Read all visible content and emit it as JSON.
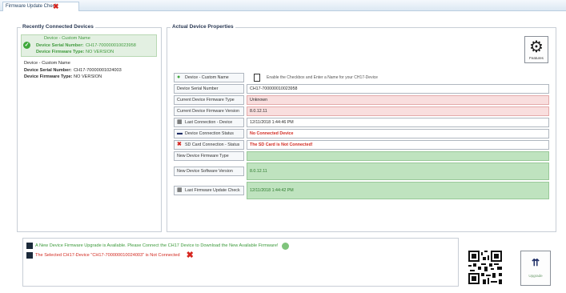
{
  "window": {
    "tab_title": "Firmware Update Check"
  },
  "recent": {
    "title": "Recently Connected Devices",
    "devices": [
      {
        "name": "Device - Custom Name",
        "serial_label": "Device Serial Number:",
        "serial": "CH17-700000010023958",
        "fw_label": "Device Firmware Type:",
        "fw": "NO VERSION"
      },
      {
        "name": "Device - Custom Name",
        "serial_label": "Device Serial Number:",
        "serial": "CH17-70000001024003",
        "fw_label": "Device Firmware Type:",
        "fw": "NO VERSION"
      }
    ]
  },
  "props": {
    "title": "Actual Device Properties",
    "features_label": "Features",
    "hint": "Enable the Checkbox and Enter a Name for your CH17-Device",
    "rows": [
      {
        "label": "Device - Custom Name",
        "value": ""
      },
      {
        "label": "Device Serial Number",
        "value": "CH17-700000010023958"
      },
      {
        "label": "Current Device Firmware Type",
        "value": "Unknown"
      },
      {
        "label": "Current Device Firmware Version",
        "value": "8.0.12.11"
      },
      {
        "label": "Last Connection - Device",
        "value": "12/11/2018 1:44:46 PM"
      },
      {
        "label": "Device Connection Status",
        "value": "No Connected Device"
      },
      {
        "label": "SD Card Connection - Status",
        "value": "The SD Card is Not Connected!"
      },
      {
        "label": "New Device Firmware Type",
        "value": ""
      },
      {
        "label": "New Device Software Version",
        "value": "8.0.12.11"
      },
      {
        "label": "Last Firmware Update Check",
        "value": "12/11/2018 1:44:42 PM"
      }
    ]
  },
  "notifications": {
    "line1": "A New Device Firmware Upgrade is Available. Please Connect the CH17 Device to Download the New Available Firmware!",
    "line2": "The Selected CH17-Device \"CH17-700000010024003\" is Not Connected"
  },
  "upgrade_label": "Upgrade",
  "colors": {
    "accent_green": "#3ea83a",
    "error_red": "#d22a21",
    "warn_bg": "#f9dede",
    "ok_bg": "#bfe3bf"
  }
}
